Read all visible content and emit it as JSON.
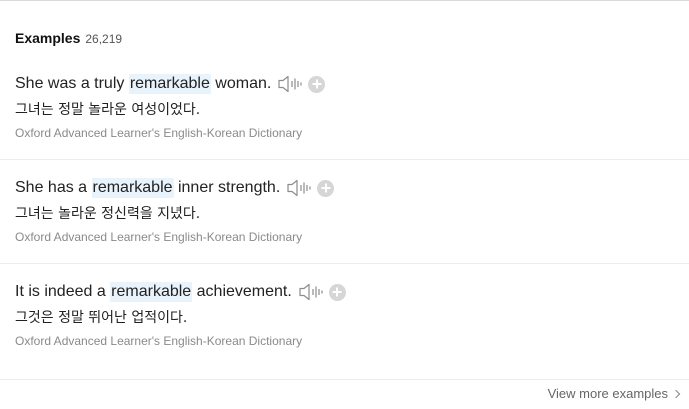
{
  "section": {
    "title": "Examples",
    "count": "26,219"
  },
  "examples": [
    {
      "en_before": "She was a truly ",
      "en_keyword": "remarkable",
      "en_after": " woman.",
      "ko": "그녀는 정말 놀라운 여성이었다.",
      "source": "Oxford Advanced Learner's English-Korean Dictionary"
    },
    {
      "en_before": "She has a ",
      "en_keyword": "remarkable",
      "en_after": " inner strength.",
      "ko": "그녀는 놀라운 정신력을 지녔다.",
      "source": "Oxford Advanced Learner's English-Korean Dictionary"
    },
    {
      "en_before": "It is indeed a ",
      "en_keyword": "remarkable",
      "en_after": " achievement.",
      "ko": "그것은 정말 뛰어난 업적이다.",
      "source": "Oxford Advanced Learner's English-Korean Dictionary"
    }
  ],
  "footer": {
    "more_label": "View more examples"
  },
  "colors": {
    "highlight": "#e9f3fb",
    "source_text": "#8a8a8a",
    "icon_gray": "#d6d6d6"
  },
  "icons": {
    "speaker": "speaker-icon",
    "add": "plus-circle-icon",
    "chevron": "chevron-right-icon"
  }
}
